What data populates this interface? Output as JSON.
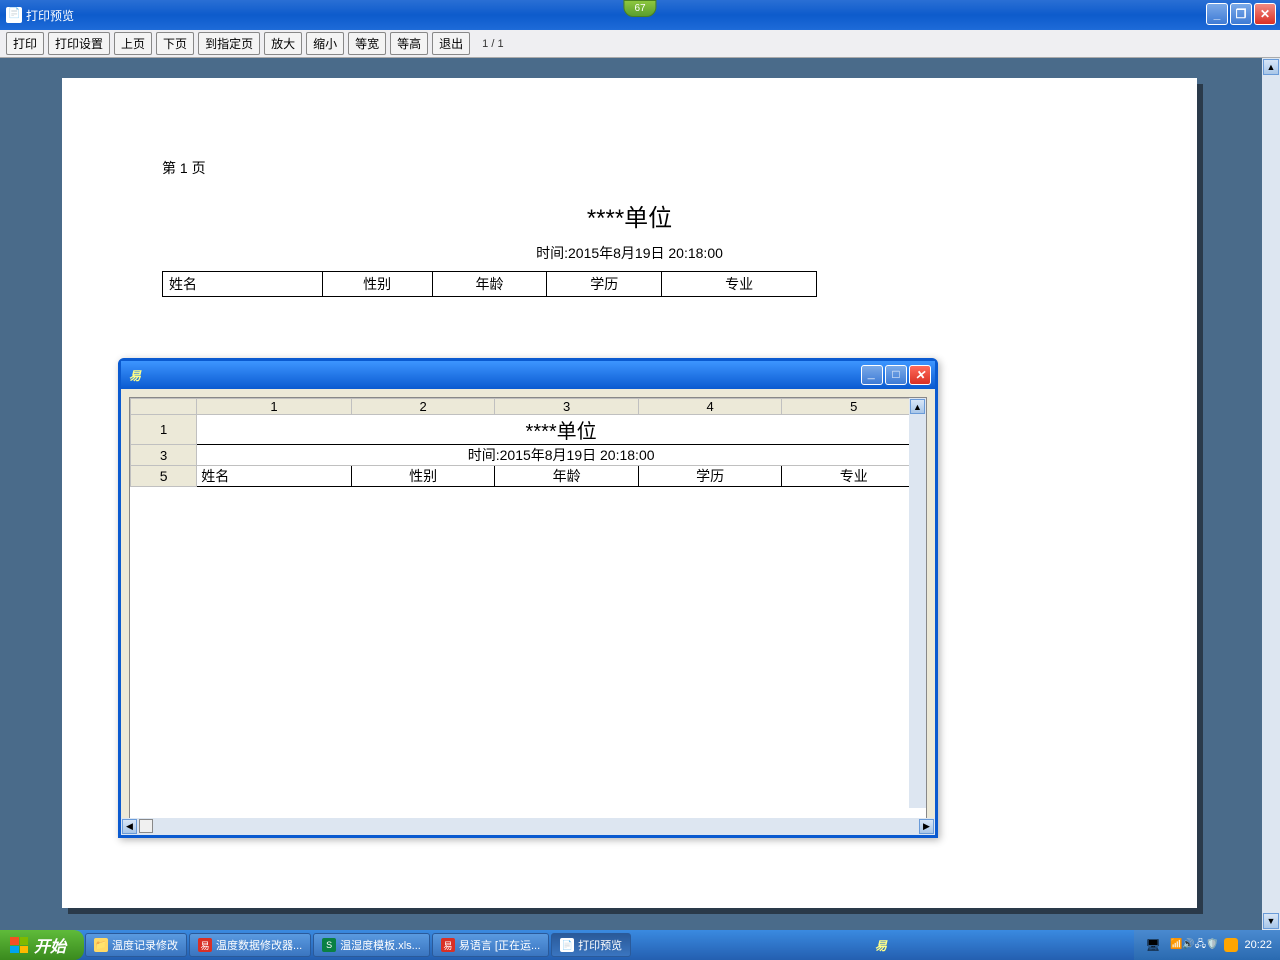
{
  "badge": "67",
  "titlebar": {
    "title": "打印预览"
  },
  "toolbar": {
    "print": "打印",
    "settings": "打印设置",
    "prev": "上页",
    "next": "下页",
    "gotoPage": "到指定页",
    "zoomIn": "放大",
    "zoomOut": "缩小",
    "fitWidth": "等宽",
    "fitHeight": "等高",
    "exit": "退出",
    "pageIndicator": "1 / 1"
  },
  "document": {
    "pageLabel": "第 1 页",
    "title": "****单位",
    "timestamp": "时间:2015年8月19日 20:18:00",
    "headers": [
      "姓名",
      "性别",
      "年龄",
      "学历",
      "专业"
    ]
  },
  "popup": {
    "icon": "易",
    "colHeaders": [
      "1",
      "2",
      "3",
      "4",
      "5"
    ],
    "rowHeaders": [
      "1",
      "3",
      "5"
    ],
    "mergedTitle": "****单位",
    "timeRow": "时间:2015年8月19日 20:18:00",
    "dataRow": [
      "姓名",
      "性别",
      "年龄",
      "学历",
      "专业"
    ]
  },
  "taskbar": {
    "start": "开始",
    "items": [
      {
        "label": "温度记录修改",
        "icon": "📁"
      },
      {
        "label": "温度数据修改器...",
        "icon": "易"
      },
      {
        "label": "温湿度模板.xls...",
        "icon": "S"
      },
      {
        "label": "易语言 [正在运...",
        "icon": "易"
      },
      {
        "label": "打印预览",
        "icon": "📄"
      }
    ],
    "clock": "20:22"
  }
}
